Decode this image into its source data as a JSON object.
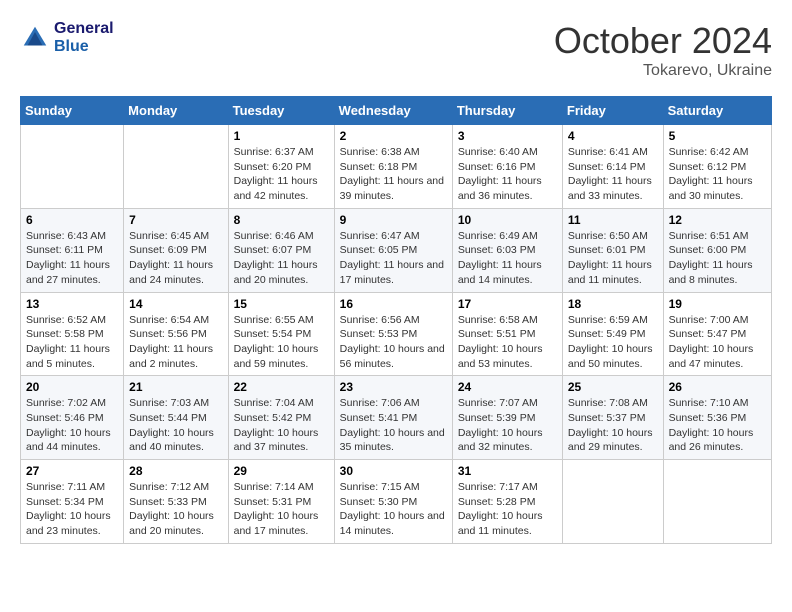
{
  "header": {
    "logo_general": "General",
    "logo_blue": "Blue",
    "month_title": "October 2024",
    "location": "Tokarevo, Ukraine"
  },
  "days_of_week": [
    "Sunday",
    "Monday",
    "Tuesday",
    "Wednesday",
    "Thursday",
    "Friday",
    "Saturday"
  ],
  "weeks": [
    [
      {
        "num": "",
        "sunrise": "",
        "sunset": "",
        "daylight": ""
      },
      {
        "num": "",
        "sunrise": "",
        "sunset": "",
        "daylight": ""
      },
      {
        "num": "1",
        "sunrise": "Sunrise: 6:37 AM",
        "sunset": "Sunset: 6:20 PM",
        "daylight": "Daylight: 11 hours and 42 minutes."
      },
      {
        "num": "2",
        "sunrise": "Sunrise: 6:38 AM",
        "sunset": "Sunset: 6:18 PM",
        "daylight": "Daylight: 11 hours and 39 minutes."
      },
      {
        "num": "3",
        "sunrise": "Sunrise: 6:40 AM",
        "sunset": "Sunset: 6:16 PM",
        "daylight": "Daylight: 11 hours and 36 minutes."
      },
      {
        "num": "4",
        "sunrise": "Sunrise: 6:41 AM",
        "sunset": "Sunset: 6:14 PM",
        "daylight": "Daylight: 11 hours and 33 minutes."
      },
      {
        "num": "5",
        "sunrise": "Sunrise: 6:42 AM",
        "sunset": "Sunset: 6:12 PM",
        "daylight": "Daylight: 11 hours and 30 minutes."
      }
    ],
    [
      {
        "num": "6",
        "sunrise": "Sunrise: 6:43 AM",
        "sunset": "Sunset: 6:11 PM",
        "daylight": "Daylight: 11 hours and 27 minutes."
      },
      {
        "num": "7",
        "sunrise": "Sunrise: 6:45 AM",
        "sunset": "Sunset: 6:09 PM",
        "daylight": "Daylight: 11 hours and 24 minutes."
      },
      {
        "num": "8",
        "sunrise": "Sunrise: 6:46 AM",
        "sunset": "Sunset: 6:07 PM",
        "daylight": "Daylight: 11 hours and 20 minutes."
      },
      {
        "num": "9",
        "sunrise": "Sunrise: 6:47 AM",
        "sunset": "Sunset: 6:05 PM",
        "daylight": "Daylight: 11 hours and 17 minutes."
      },
      {
        "num": "10",
        "sunrise": "Sunrise: 6:49 AM",
        "sunset": "Sunset: 6:03 PM",
        "daylight": "Daylight: 11 hours and 14 minutes."
      },
      {
        "num": "11",
        "sunrise": "Sunrise: 6:50 AM",
        "sunset": "Sunset: 6:01 PM",
        "daylight": "Daylight: 11 hours and 11 minutes."
      },
      {
        "num": "12",
        "sunrise": "Sunrise: 6:51 AM",
        "sunset": "Sunset: 6:00 PM",
        "daylight": "Daylight: 11 hours and 8 minutes."
      }
    ],
    [
      {
        "num": "13",
        "sunrise": "Sunrise: 6:52 AM",
        "sunset": "Sunset: 5:58 PM",
        "daylight": "Daylight: 11 hours and 5 minutes."
      },
      {
        "num": "14",
        "sunrise": "Sunrise: 6:54 AM",
        "sunset": "Sunset: 5:56 PM",
        "daylight": "Daylight: 11 hours and 2 minutes."
      },
      {
        "num": "15",
        "sunrise": "Sunrise: 6:55 AM",
        "sunset": "Sunset: 5:54 PM",
        "daylight": "Daylight: 10 hours and 59 minutes."
      },
      {
        "num": "16",
        "sunrise": "Sunrise: 6:56 AM",
        "sunset": "Sunset: 5:53 PM",
        "daylight": "Daylight: 10 hours and 56 minutes."
      },
      {
        "num": "17",
        "sunrise": "Sunrise: 6:58 AM",
        "sunset": "Sunset: 5:51 PM",
        "daylight": "Daylight: 10 hours and 53 minutes."
      },
      {
        "num": "18",
        "sunrise": "Sunrise: 6:59 AM",
        "sunset": "Sunset: 5:49 PM",
        "daylight": "Daylight: 10 hours and 50 minutes."
      },
      {
        "num": "19",
        "sunrise": "Sunrise: 7:00 AM",
        "sunset": "Sunset: 5:47 PM",
        "daylight": "Daylight: 10 hours and 47 minutes."
      }
    ],
    [
      {
        "num": "20",
        "sunrise": "Sunrise: 7:02 AM",
        "sunset": "Sunset: 5:46 PM",
        "daylight": "Daylight: 10 hours and 44 minutes."
      },
      {
        "num": "21",
        "sunrise": "Sunrise: 7:03 AM",
        "sunset": "Sunset: 5:44 PM",
        "daylight": "Daylight: 10 hours and 40 minutes."
      },
      {
        "num": "22",
        "sunrise": "Sunrise: 7:04 AM",
        "sunset": "Sunset: 5:42 PM",
        "daylight": "Daylight: 10 hours and 37 minutes."
      },
      {
        "num": "23",
        "sunrise": "Sunrise: 7:06 AM",
        "sunset": "Sunset: 5:41 PM",
        "daylight": "Daylight: 10 hours and 35 minutes."
      },
      {
        "num": "24",
        "sunrise": "Sunrise: 7:07 AM",
        "sunset": "Sunset: 5:39 PM",
        "daylight": "Daylight: 10 hours and 32 minutes."
      },
      {
        "num": "25",
        "sunrise": "Sunrise: 7:08 AM",
        "sunset": "Sunset: 5:37 PM",
        "daylight": "Daylight: 10 hours and 29 minutes."
      },
      {
        "num": "26",
        "sunrise": "Sunrise: 7:10 AM",
        "sunset": "Sunset: 5:36 PM",
        "daylight": "Daylight: 10 hours and 26 minutes."
      }
    ],
    [
      {
        "num": "27",
        "sunrise": "Sunrise: 7:11 AM",
        "sunset": "Sunset: 5:34 PM",
        "daylight": "Daylight: 10 hours and 23 minutes."
      },
      {
        "num": "28",
        "sunrise": "Sunrise: 7:12 AM",
        "sunset": "Sunset: 5:33 PM",
        "daylight": "Daylight: 10 hours and 20 minutes."
      },
      {
        "num": "29",
        "sunrise": "Sunrise: 7:14 AM",
        "sunset": "Sunset: 5:31 PM",
        "daylight": "Daylight: 10 hours and 17 minutes."
      },
      {
        "num": "30",
        "sunrise": "Sunrise: 7:15 AM",
        "sunset": "Sunset: 5:30 PM",
        "daylight": "Daylight: 10 hours and 14 minutes."
      },
      {
        "num": "31",
        "sunrise": "Sunrise: 7:17 AM",
        "sunset": "Sunset: 5:28 PM",
        "daylight": "Daylight: 10 hours and 11 minutes."
      },
      {
        "num": "",
        "sunrise": "",
        "sunset": "",
        "daylight": ""
      },
      {
        "num": "",
        "sunrise": "",
        "sunset": "",
        "daylight": ""
      }
    ]
  ]
}
